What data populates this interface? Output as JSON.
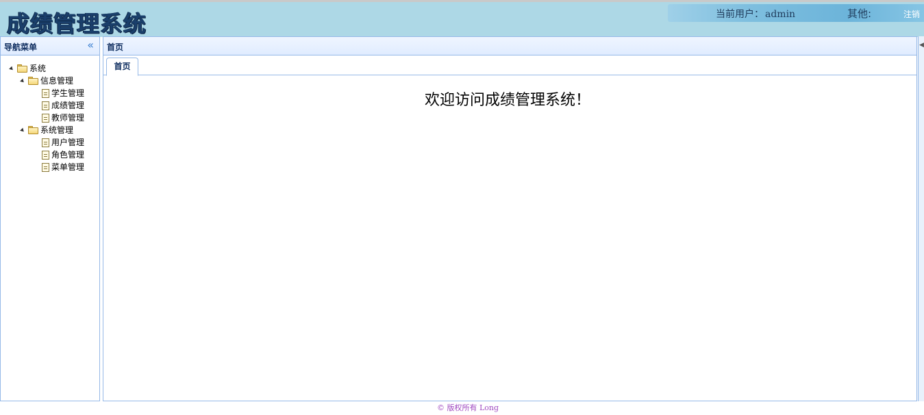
{
  "header": {
    "logo_text": "成绩管理系统",
    "current_user_label": "当前用户：",
    "current_user": "admin",
    "other_label": "其他:",
    "logout_label": "注销"
  },
  "nav": {
    "title": "导航菜单",
    "collapse_icon": "«",
    "tree": {
      "root": "系统",
      "groups": [
        {
          "label": "信息管理",
          "items": [
            "学生管理",
            "成绩管理",
            "教师管理"
          ]
        },
        {
          "label": "系统管理",
          "items": [
            "用户管理",
            "角色管理",
            "菜单管理"
          ]
        }
      ]
    }
  },
  "main": {
    "panel_title": "首页",
    "tabs": [
      {
        "label": "首页"
      }
    ],
    "welcome_text": "欢迎访问成绩管理系统！"
  },
  "east": {
    "expand_icon": "◀"
  },
  "footer": {
    "text": "© 版权所有 Long"
  },
  "colors": {
    "header_bg": "#add8e6",
    "panel_border": "#95b8e7",
    "title_text": "#0e2d5f",
    "footer_text": "#a04ac0"
  }
}
